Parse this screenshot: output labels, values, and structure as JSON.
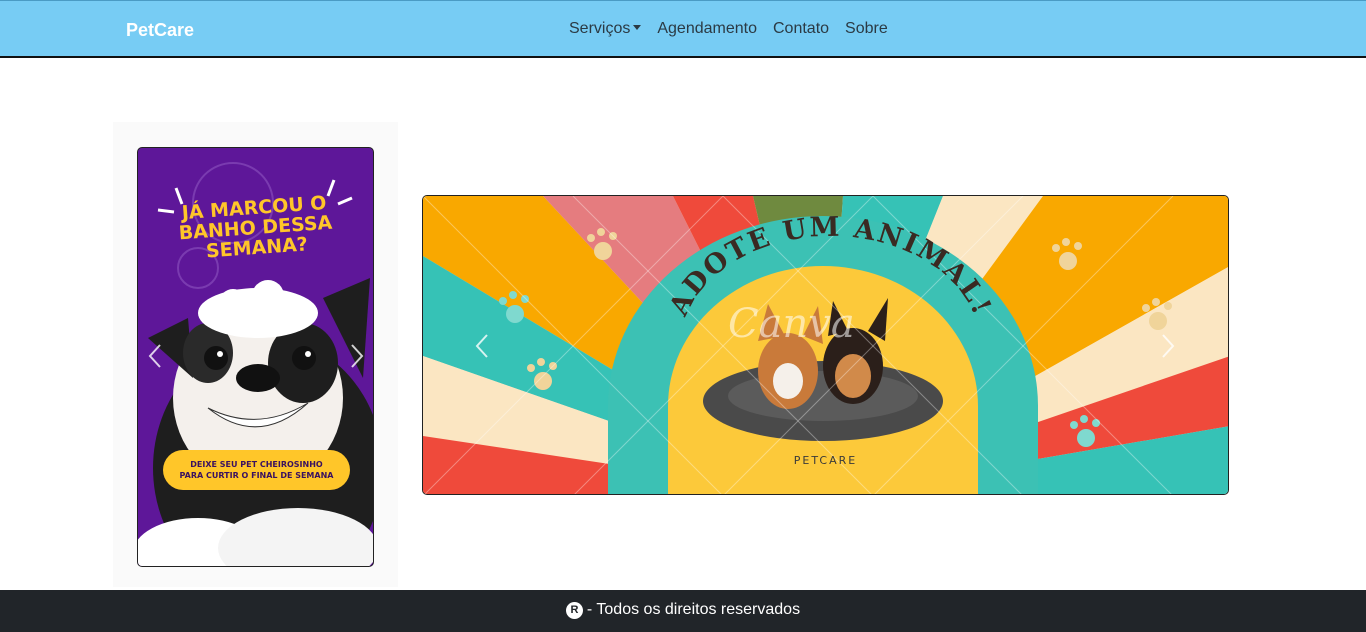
{
  "navbar": {
    "brand": "PetCare",
    "items": [
      {
        "label": "Serviços",
        "dropdown": true
      },
      {
        "label": "Agendamento"
      },
      {
        "label": "Contato"
      },
      {
        "label": "Sobre"
      }
    ],
    "background": "#77ccf4"
  },
  "side_ad": {
    "headline": "JÁ MARCOU O\nBANHO DESSA\nSEMANA?",
    "pill_text": "DEIXE SEU PET CHEIROSINHO\nPARA CURTIR O FINAL DE SEMANA",
    "background": "#5e1799",
    "accent": "#ffc629"
  },
  "main_ad": {
    "title": "ADOTE UM ANIMAL!",
    "label": "PETCARE",
    "watermark": "Canva"
  },
  "footer": {
    "symbol": "R",
    "text": "- Todos os direitos reservados"
  }
}
